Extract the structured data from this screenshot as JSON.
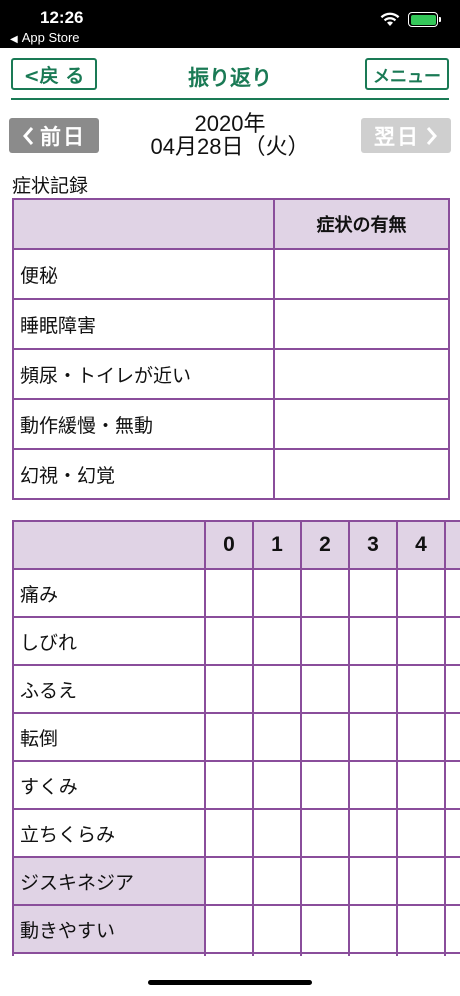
{
  "status_bar": {
    "time": "12:26",
    "back_app": "App Store",
    "back_arrow": "◀"
  },
  "nav": {
    "back_label": "<戻 る",
    "title": "振り返り",
    "menu_label": "メニュー"
  },
  "date_nav": {
    "prev_label": "前日",
    "next_label": "翌日",
    "year": "2020年",
    "date": "04月28日（火）"
  },
  "section_title": "症状記録",
  "presence_table": {
    "header": "症状の有無",
    "rows": [
      "便秘",
      "睡眠障害",
      "頻尿・トイレが近い",
      "動作緩慢・無動",
      "幻視・幻覚"
    ]
  },
  "severity_table": {
    "columns": [
      "0",
      "1",
      "2",
      "3",
      "4"
    ],
    "rows": [
      {
        "label": "痛み",
        "shaded": false
      },
      {
        "label": "しびれ",
        "shaded": false
      },
      {
        "label": "ふるえ",
        "shaded": false
      },
      {
        "label": "転倒",
        "shaded": false
      },
      {
        "label": "すくみ",
        "shaded": false
      },
      {
        "label": "立ちくらみ",
        "shaded": false
      },
      {
        "label": "ジスキネジア",
        "shaded": true
      },
      {
        "label": "動きやすい",
        "shaded": true
      },
      {
        "label": "",
        "shaded": false
      }
    ]
  },
  "colors": {
    "accent_green": "#1a7a55",
    "table_border": "#8a4e9b",
    "header_fill": "#e0d3e5"
  }
}
